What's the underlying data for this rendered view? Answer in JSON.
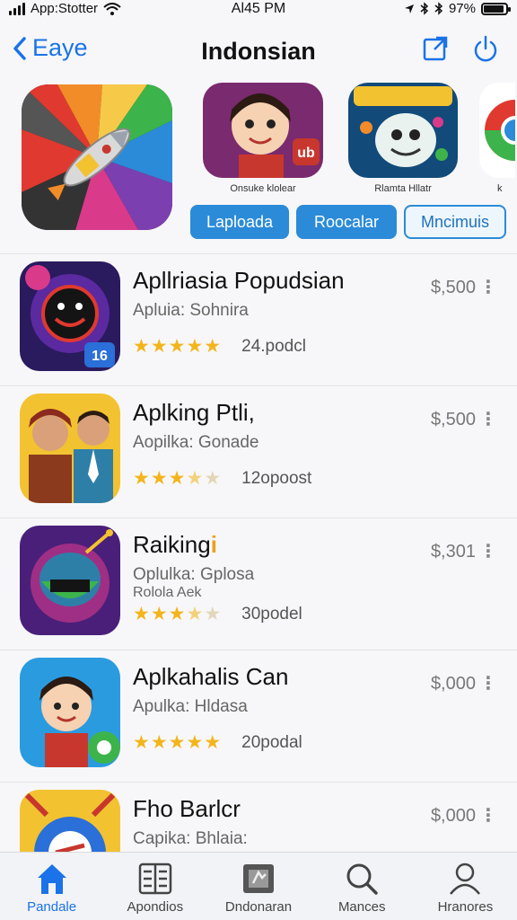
{
  "status_bar": {
    "carrier": "App:Stotter",
    "time": "Al45 PM",
    "battery": "97%",
    "icons": [
      "signal-icon",
      "wifi-icon",
      "location-icon",
      "bluetooth-icon",
      "battery-icon"
    ]
  },
  "nav": {
    "back_label": "Eaye",
    "title": "Indonsian",
    "actions": [
      "compose-icon",
      "power-icon"
    ]
  },
  "featured": {
    "apps": [
      {
        "caption": "Onsuke klolear"
      },
      {
        "caption": "Rlamta Hllatr"
      },
      {
        "caption": "k"
      }
    ],
    "chips": [
      {
        "label": "Laploada"
      },
      {
        "label": "Roocalar"
      },
      {
        "label": "Mncimuis"
      }
    ],
    "badge_text": "ub"
  },
  "list": {
    "items": [
      {
        "title": "Apllriasia Popudsian",
        "subtitle": "Apluia: Sohnira",
        "subtitle2": "",
        "rating": 5,
        "count": "24.podcl",
        "price": "$,500",
        "badge": "16"
      },
      {
        "title": "Aplking Ptli,",
        "subtitle": "Aopilka: Gonade",
        "subtitle2": "",
        "rating": 3.5,
        "count": "12opoost",
        "price": "$,500",
        "badge": ""
      },
      {
        "title": "Raiking",
        "subtitle": "Oplulka: Gplosa",
        "subtitle2": "Rolola Aek",
        "rating": 3.5,
        "count": "30podel",
        "price": "$,301",
        "badge": ""
      },
      {
        "title": "Aplkahalis Can",
        "subtitle": "Apulka: Hldasa",
        "subtitle2": "",
        "rating": 5,
        "count": "20podal",
        "price": "$,000",
        "badge": ""
      },
      {
        "title": "Fho Barlcr",
        "subtitle": "Capika: Bhlaia:",
        "subtitle2": "",
        "rating": 0,
        "count": "",
        "price": "$,000",
        "badge": ""
      }
    ]
  },
  "tabbar": {
    "tabs": [
      {
        "label": "Pandale",
        "icon": "home-icon",
        "active": true
      },
      {
        "label": "Apondios",
        "icon": "apps-icon",
        "active": false
      },
      {
        "label": "Dndonaran",
        "icon": "updates-icon",
        "active": false
      },
      {
        "label": "Mances",
        "icon": "search-icon",
        "active": false
      },
      {
        "label": "Hranores",
        "icon": "person-icon",
        "active": false
      }
    ]
  },
  "colors": {
    "accent": "#1a73e8",
    "chip_fill": "#2b8bd8",
    "star": "#f3b51c"
  }
}
